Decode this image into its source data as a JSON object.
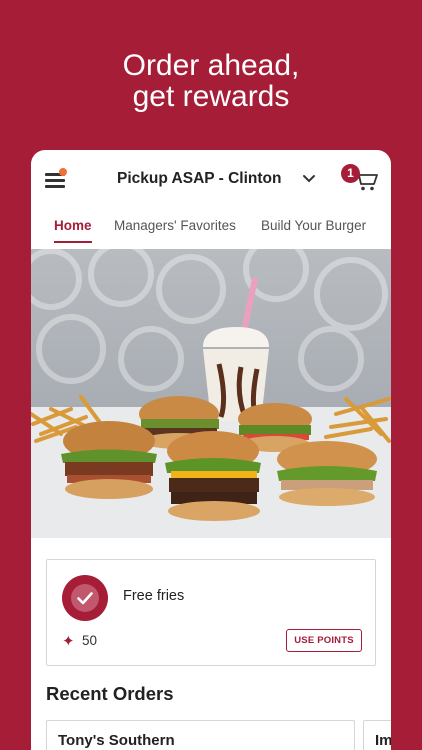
{
  "headline": {
    "line1": "Order ahead,",
    "line2": "get rewards"
  },
  "header": {
    "location": "Pickup ASAP - Clinton",
    "cart_count": "1"
  },
  "tabs": [
    {
      "label": "Home",
      "active": true
    },
    {
      "label": "Managers' Favorites",
      "active": false
    },
    {
      "label": "Build Your Burger",
      "active": false
    }
  ],
  "reward": {
    "name": "Free fries",
    "points": "50",
    "button": "USE POINTS"
  },
  "recent_orders": {
    "title": "Recent Orders",
    "items": [
      {
        "name": "Tony's Southern"
      },
      {
        "name": "Im"
      }
    ]
  },
  "colors": {
    "brand": "#a51d37",
    "notification": "#f0703c"
  },
  "icons": [
    "menu-icon",
    "chevron-down-icon",
    "cart-icon",
    "check-seal-icon",
    "star-icon"
  ]
}
